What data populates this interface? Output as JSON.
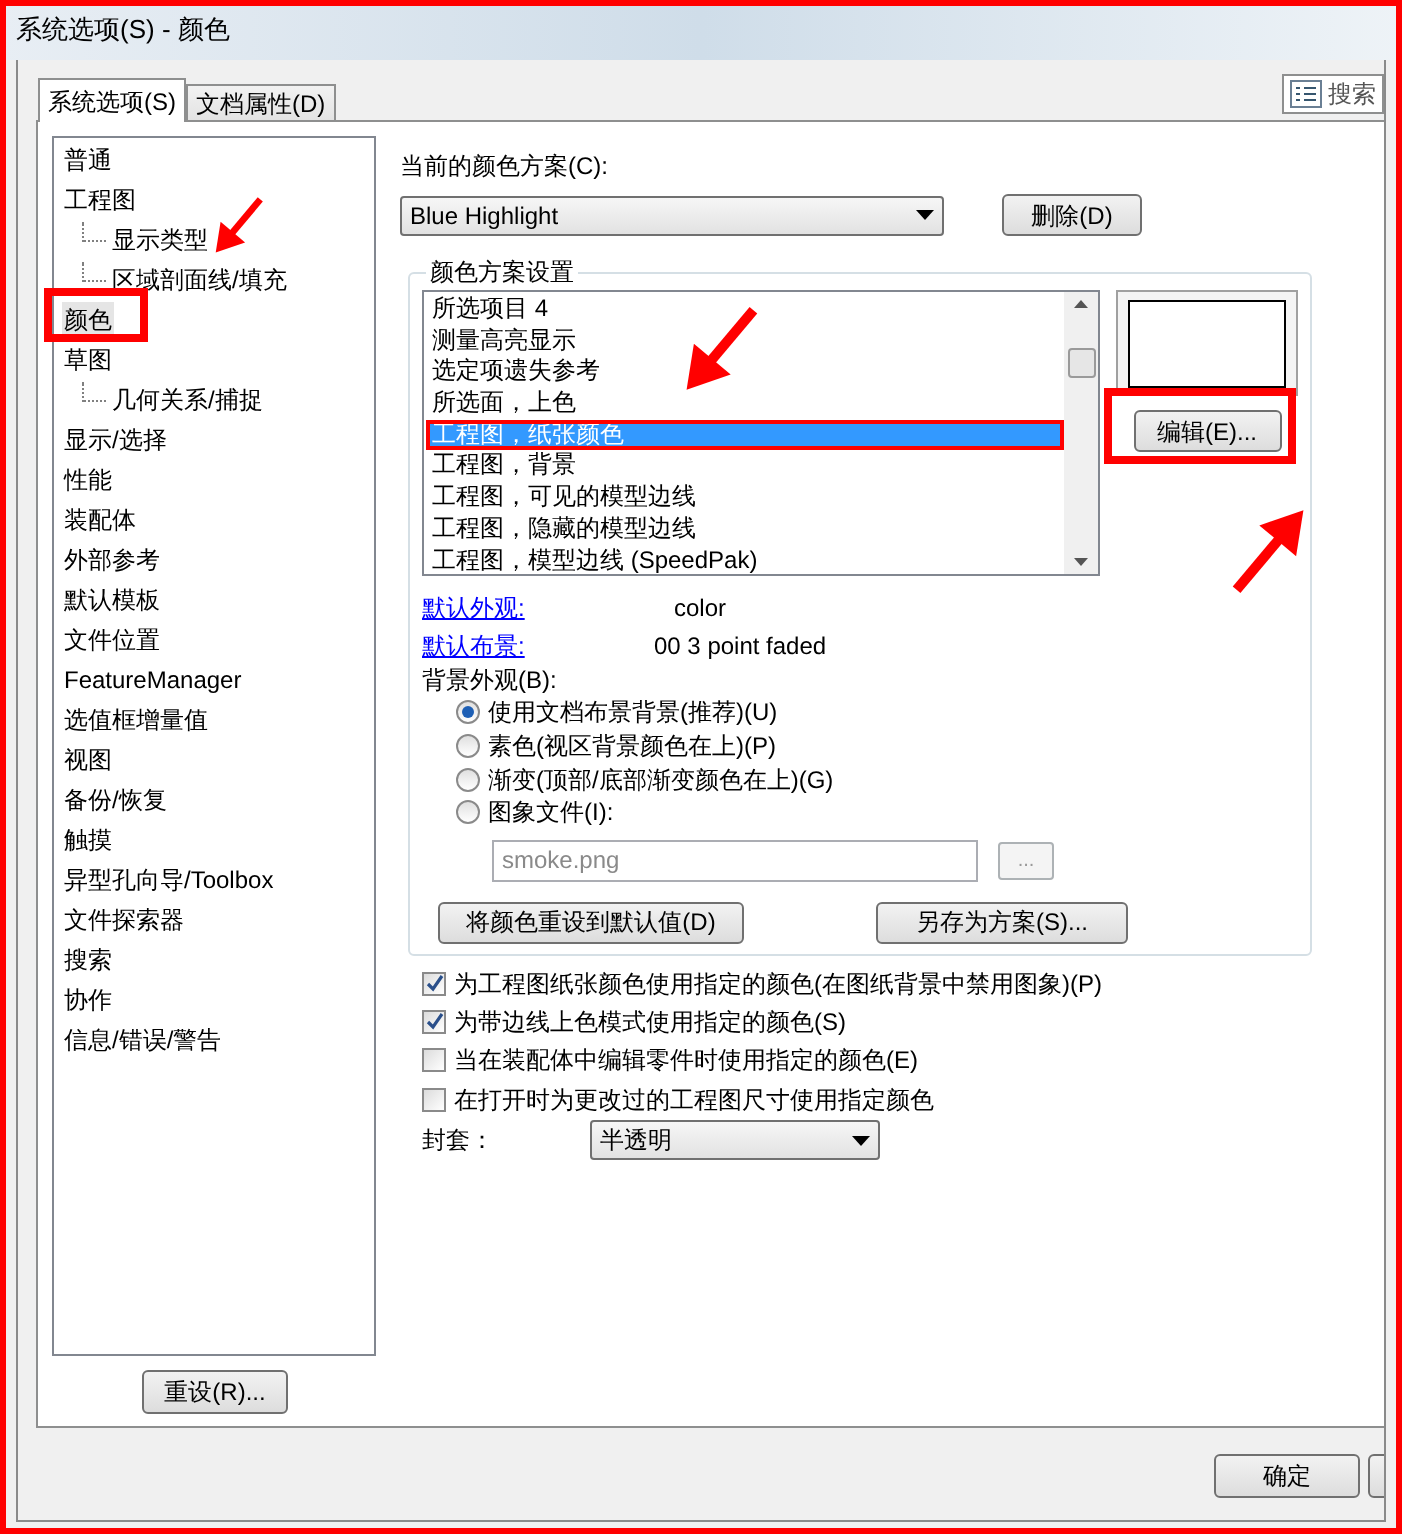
{
  "window": {
    "title": "系统选项(S) - 颜色"
  },
  "tabs": [
    {
      "label": "系统选项(S)",
      "selected": true
    },
    {
      "label": "文档属性(D)",
      "selected": false
    }
  ],
  "search_button": {
    "label": "搜索"
  },
  "sidebar": {
    "items": [
      {
        "label": "普通",
        "selected": false
      },
      {
        "label": "工程图",
        "selected": false,
        "children": [
          {
            "label": "显示类型",
            "selected": false
          },
          {
            "label": "区域剖面线/填充",
            "selected": false
          }
        ]
      },
      {
        "label": "颜色",
        "selected": true
      },
      {
        "label": "草图",
        "selected": false,
        "children": [
          {
            "label": "几何关系/捕捉",
            "selected": false
          }
        ]
      },
      {
        "label": "显示/选择",
        "selected": false
      },
      {
        "label": "性能",
        "selected": false
      },
      {
        "label": "装配体",
        "selected": false
      },
      {
        "label": "外部参考",
        "selected": false
      },
      {
        "label": "默认模板",
        "selected": false
      },
      {
        "label": "文件位置",
        "selected": false
      },
      {
        "label": "FeatureManager",
        "selected": false
      },
      {
        "label": "选值框增量值",
        "selected": false
      },
      {
        "label": "视图",
        "selected": false
      },
      {
        "label": "备份/恢复",
        "selected": false
      },
      {
        "label": "触摸",
        "selected": false
      },
      {
        "label": "异型孔向导/Toolbox",
        "selected": false
      },
      {
        "label": "文件探索器",
        "selected": false
      },
      {
        "label": "搜索",
        "selected": false
      },
      {
        "label": "协作",
        "selected": false
      },
      {
        "label": "信息/错误/警告",
        "selected": false
      }
    ],
    "reset_button": "重设(R)..."
  },
  "scheme": {
    "label": "当前的颜色方案(C):",
    "value": "Blue Highlight",
    "delete_button": "删除(D)"
  },
  "settings": {
    "legend": "颜色方案设置",
    "items": [
      {
        "label": "所选项目 4",
        "selected": false
      },
      {
        "label": "测量高亮显示",
        "selected": false
      },
      {
        "label": "选定项遗失参考",
        "selected": false
      },
      {
        "label": "所选面，上色",
        "selected": false
      },
      {
        "label": "工程图，纸张颜色",
        "selected": true
      },
      {
        "label": "工程图，背景",
        "selected": false
      },
      {
        "label": "工程图，可见的模型边线",
        "selected": false
      },
      {
        "label": "工程图，隐藏的模型边线",
        "selected": false
      },
      {
        "label": "工程图，模型边线 (SpeedPak)",
        "selected": false
      }
    ],
    "edit_button": "编辑(E)...",
    "links": [
      {
        "label": "默认外观:",
        "value": "color"
      },
      {
        "label": "默认布景:",
        "value": "00 3 point faded"
      }
    ],
    "background_label": "背景外观(B):",
    "options": [
      {
        "label": "使用文档布景背景(推荐)(U)",
        "selected": true
      },
      {
        "label": "素色(视区背景颜色在上)(P)",
        "selected": false
      },
      {
        "label": "渐变(顶部/底部渐变颜色在上)(G)",
        "selected": false
      },
      {
        "label": "图象文件(I):",
        "selected": false
      }
    ],
    "image_file": {
      "value": "smoke.png"
    },
    "browse_button": "...",
    "reset_colors_button": "将颜色重设到默认值(D)",
    "save_scheme_button": "另存为方案(S)..."
  },
  "checkboxes": [
    {
      "label": "为工程图纸张颜色使用指定的颜色(在图纸背景中禁用图象)(P)",
      "checked": true
    },
    {
      "label": "为带边线上色模式使用指定的颜色(S)",
      "checked": true
    },
    {
      "label": "当在装配体中编辑零件时使用指定的颜色(E)",
      "checked": false
    },
    {
      "label": "在打开时为更改过的工程图尺寸使用指定颜色",
      "checked": false
    }
  ],
  "envelope": {
    "label": "封套：",
    "value": "半透明"
  },
  "footer": {
    "ok_button": "确定"
  }
}
